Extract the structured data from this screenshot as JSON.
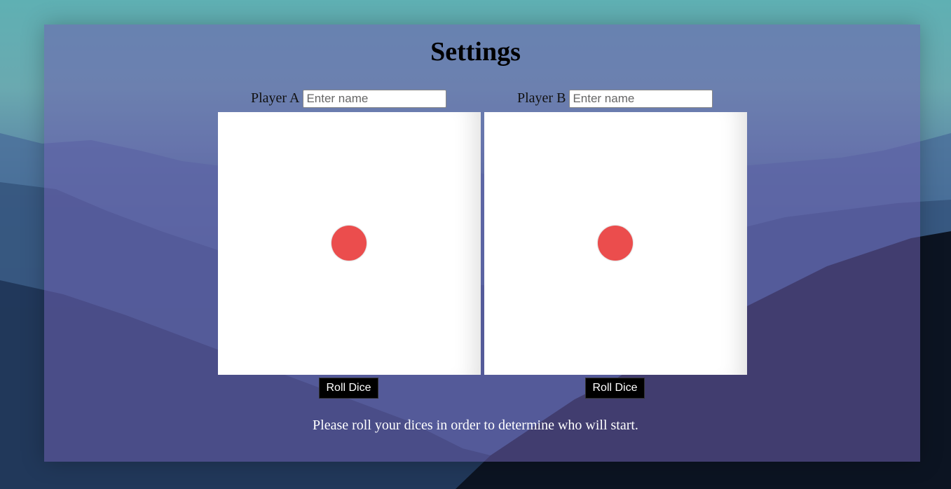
{
  "page": {
    "title": "Settings"
  },
  "players": [
    {
      "label": "Player A",
      "name_placeholder": "Enter name",
      "name_value": "",
      "roll_label": "Roll Dice",
      "die_value": 1
    },
    {
      "label": "Player B",
      "name_placeholder": "Enter name",
      "name_value": "",
      "roll_label": "Roll Dice",
      "die_value": 1
    }
  ],
  "status": {
    "message": "Please roll your dices in order to determine who will start."
  },
  "colors": {
    "pip": "#eb4d4d",
    "panel_overlay": "#6e5faf",
    "button_bg": "#000000",
    "button_text": "#ffffff"
  },
  "icons": {
    "pip": "die-pip-icon"
  }
}
